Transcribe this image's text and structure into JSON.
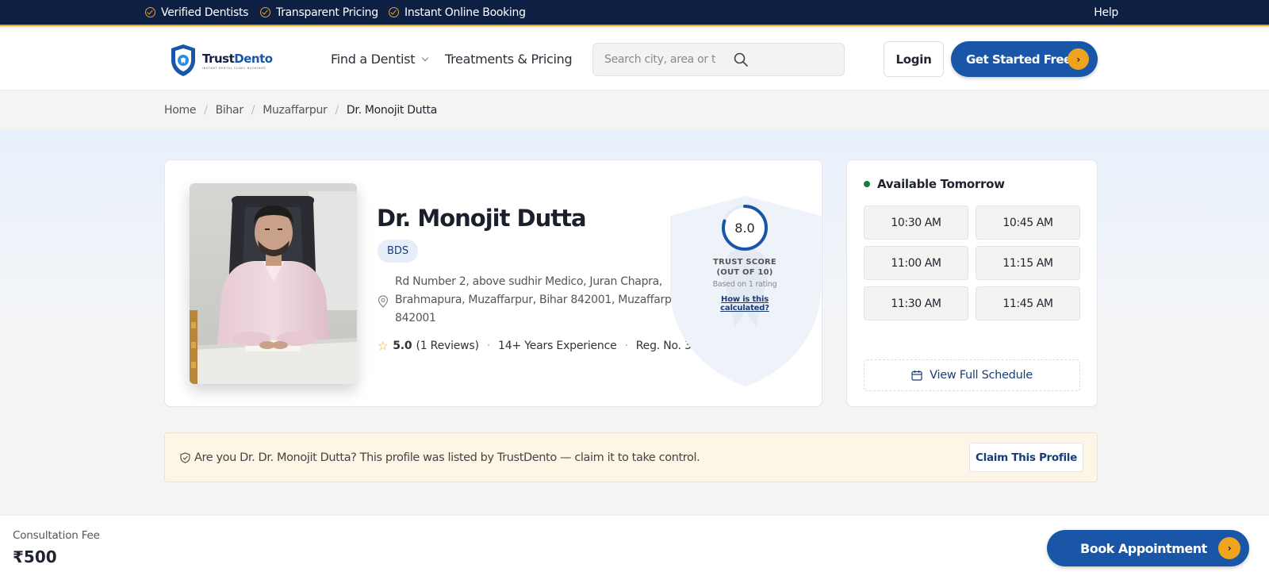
{
  "topbar": {
    "features": [
      "Verified Dentists",
      "Transparent Pricing",
      "Instant Online Booking"
    ],
    "help": "Help"
  },
  "header": {
    "logo": {
      "name_a": "Trust",
      "name_b": "Dento",
      "tagline": "INSTANT DENTAL CLINIC BOOKINGS"
    },
    "nav": {
      "find": "Find a Dentist",
      "treatments": "Treatments & Pricing"
    },
    "search": {
      "placeholder": "Search city, area or treatment"
    },
    "login": "Login",
    "cta": "Get Started Free"
  },
  "breadcrumb": [
    "Home",
    "Bihar",
    "Muzaffarpur",
    "Dr. Monojit Dutta"
  ],
  "profile": {
    "name": "Dr. Monojit Dutta",
    "qualification": "BDS",
    "address": "Rd Number 2, above sudhir Medico, Juran Chapra, Brahmapura, Muzaffarpur, Bihar 842001, Muzaffarpur, 842001",
    "rating": "5.0",
    "reviews": "(1 Reviews)",
    "experience": "14+ Years Experience",
    "reg": "Reg. No. 32××",
    "trust": {
      "score": "8.0",
      "score_fraction": 0.8,
      "label_1": "TRUST SCORE",
      "label_2": "(OUT OF 10)",
      "based": "Based on 1 rating",
      "how": "How is this calculated?"
    }
  },
  "schedule": {
    "availability": "Available Tomorrow",
    "slots": [
      "10:30 AM",
      "10:45 AM",
      "11:00 AM",
      "11:15 AM",
      "11:30 AM",
      "11:45 AM"
    ],
    "full": "View Full Schedule"
  },
  "claim": {
    "text": "Are you Dr. Dr. Monojit Dutta? This profile was listed by TrustDento — claim it to take control.",
    "button": "Claim This Profile"
  },
  "bottom": {
    "fee_label": "Consultation Fee",
    "fee_value": "₹500",
    "book": "Book Appointment"
  },
  "colors": {
    "navy": "#0e1f44",
    "brand_blue": "#1a56a8",
    "accent_orange": "#f0a41c",
    "available_green": "#1e7a3f"
  }
}
